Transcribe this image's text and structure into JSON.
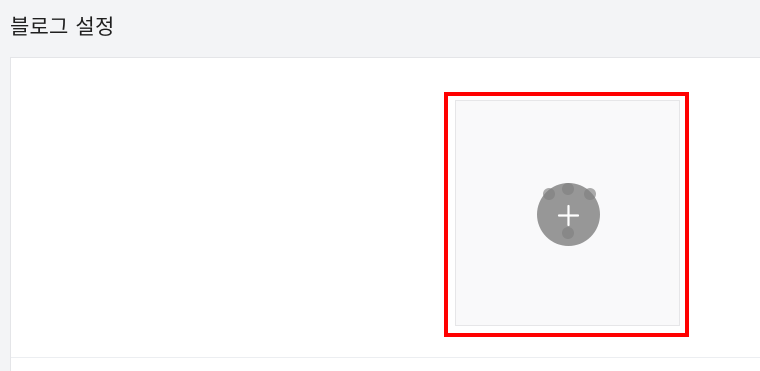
{
  "header": {
    "title": "블로그 설정"
  },
  "upload": {
    "icon": "plus-icon"
  },
  "colors": {
    "highlight": "#ff0000",
    "button_bg": "#979797",
    "panel_bg": "#ffffff",
    "page_bg": "#f3f4f6"
  }
}
